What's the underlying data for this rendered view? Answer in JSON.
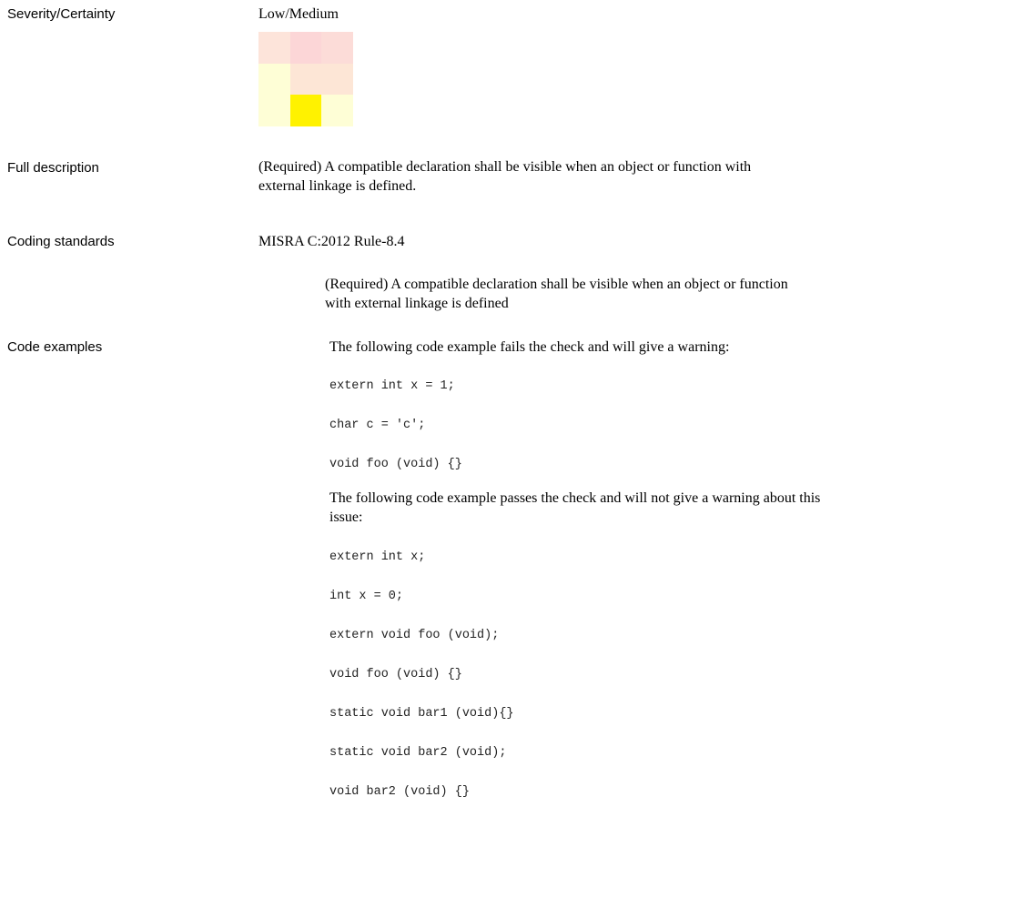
{
  "rows": {
    "severity_label": "Severity/Certainty",
    "severity_value": "Low/Medium",
    "severity_grid": [
      [
        "#fde4da",
        "#fcd6d7",
        "#fcdcd8"
      ],
      [
        "#fefed6",
        "#fde6d6",
        "#fde6d6"
      ],
      [
        "#fefed6",
        "#fff200",
        "#fefed6"
      ]
    ],
    "full_desc_label": "Full description",
    "full_desc_text": " (Required) A compatible declaration shall be visible when an object or function with external linkage is defined.",
    "coding_label": "Coding standards",
    "coding_standard": "MISRA C:2012 Rule-8.4",
    "coding_text": "(Required) A compatible declaration shall be visible when an object or function with external linkage is defined",
    "code_label": "Code examples",
    "fail_intro": "The following code example fails the check and will give a warning:",
    "fail_code": [
      "extern int x = 1;",
      "char c = 'c';",
      "void foo (void) {}"
    ],
    "pass_intro": "The following code example passes the check and will not give a warning about this issue:",
    "pass_code": [
      "extern int x;",
      "int x = 0;",
      "extern void foo (void);",
      "void foo (void) {}",
      "static void bar1 (void){}",
      "static void bar2 (void);",
      "void bar2 (void) {}"
    ]
  }
}
